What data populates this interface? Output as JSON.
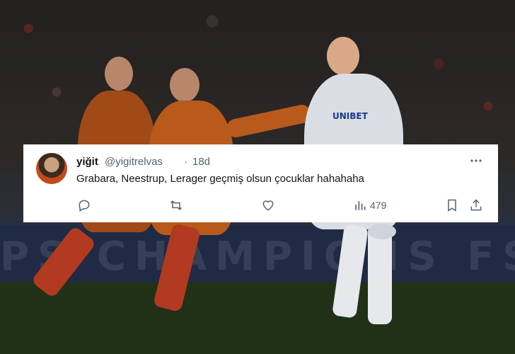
{
  "tweet": {
    "display_name": "yiğit",
    "handle": "@yigitrelvas",
    "separator": "·",
    "age": "18d",
    "text": "Grabara, Neestrup, Lerager geçmiş olsun çocuklar hahahaha",
    "more_icon": "more-horizontal-icon",
    "actions": {
      "reply_icon": "reply-icon",
      "retweet_icon": "retweet-icon",
      "like_icon": "heart-icon",
      "views_icon": "views-icon",
      "views_count": "479",
      "bookmark_icon": "bookmark-icon",
      "share_icon": "share-icon"
    }
  },
  "background": {
    "sponsor_text": "UNIBET",
    "board_text": "PS    CHAMPIONS     FS",
    "colors": {
      "galatasaray_kit": "#a04a18",
      "copenhagen_kit": "#d9dde4",
      "pitch": "#203118"
    }
  }
}
